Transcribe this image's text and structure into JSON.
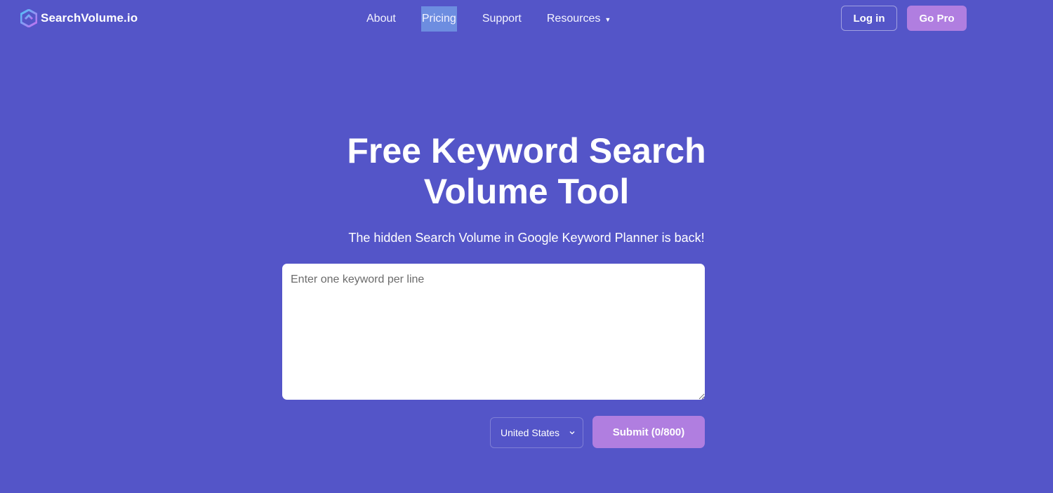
{
  "brand": {
    "name": "SearchVolume.io",
    "logo_icon": "hexagon-logo-icon",
    "colors": {
      "logo_start": "#4fc3f7",
      "logo_end": "#c56cf0"
    }
  },
  "nav": {
    "items": [
      {
        "label": "About"
      },
      {
        "label": "Pricing"
      },
      {
        "label": "Support"
      },
      {
        "label": "Resources"
      }
    ],
    "resources_icon": "caret-down-icon"
  },
  "header_actions": {
    "login_label": "Log in",
    "gopro_label": "Go Pro"
  },
  "hero": {
    "title_line1": "Free Keyword Search",
    "title_line2": "Volume Tool",
    "subtitle": "The hidden Search Volume in Google Keyword Planner is back!"
  },
  "form": {
    "keywords_placeholder": "Enter one keyword per line",
    "keywords_value": "",
    "country_selected": "United States",
    "country_icon": "chevron-down-icon",
    "submit_label": "Submit (0/800)"
  },
  "theme": {
    "background": "#5455c8",
    "accent": "#b07ee0",
    "highlight": "#6d8de0"
  }
}
